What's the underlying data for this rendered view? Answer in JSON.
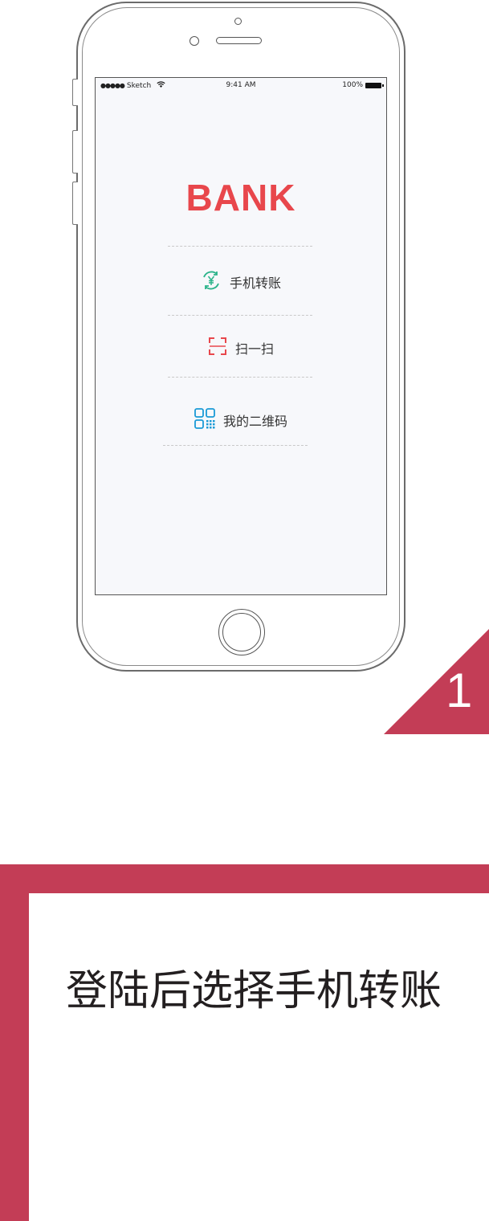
{
  "status_bar": {
    "signal": "●●●●●",
    "carrier": "Sketch",
    "time": "9:41 AM",
    "battery": "100%"
  },
  "app": {
    "brand": "BANK",
    "menu": [
      {
        "label": "手机转账",
        "icon": "yuan-transfer-icon",
        "color": "#2bb38a"
      },
      {
        "label": "扫一扫",
        "icon": "scan-icon",
        "color": "#e8474c"
      },
      {
        "label": "我的二维码",
        "icon": "qr-code-icon",
        "color": "#1a9ad6"
      }
    ]
  },
  "step": {
    "number": "1",
    "caption": "登陆后选择手机转账",
    "accent_color": "#c33d56"
  }
}
